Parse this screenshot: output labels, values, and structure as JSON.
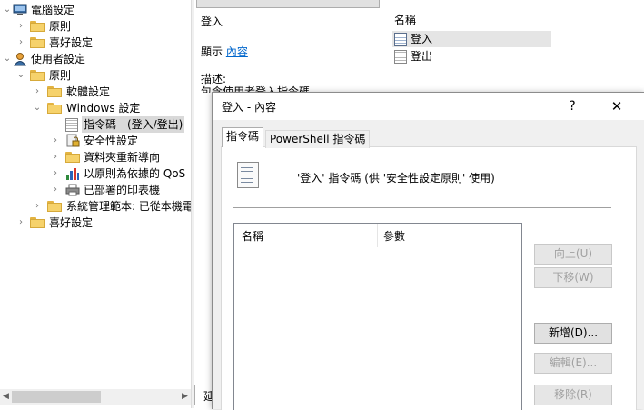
{
  "tree": {
    "items": [
      {
        "label": "電腦設定"
      },
      {
        "label": "原則"
      },
      {
        "label": "喜好設定"
      },
      {
        "label": "使用者設定"
      },
      {
        "label": "原則"
      },
      {
        "label": "軟體設定"
      },
      {
        "label": "Windows 設定"
      },
      {
        "label": "指令碼 - (登入/登出)"
      },
      {
        "label": "安全性設定"
      },
      {
        "label": "資料夾重新導向"
      },
      {
        "label": "以原則為依據的 QoS"
      },
      {
        "label": "已部署的印表機"
      },
      {
        "label": "系統管理範本: 已從本機電"
      },
      {
        "label": "喜好設定"
      }
    ]
  },
  "detail": {
    "title": "登入",
    "display_prefix": "顯示 ",
    "display_link": "內容",
    "desc_label": "描述:",
    "desc_text": "包含使用者登入指令碼。"
  },
  "list": {
    "header": "名稱",
    "items": [
      {
        "label": "登入"
      },
      {
        "label": "登出"
      }
    ]
  },
  "bottom_tab": "延",
  "dialog": {
    "title": "登入 - 內容",
    "help": "?",
    "close": "✕",
    "tabs": [
      "指令碼",
      "PowerShell 指令碼"
    ],
    "info": "'登入' 指令碼 (供 '安全性設定原則' 使用)",
    "table_headers": [
      "名稱",
      "參數"
    ],
    "buttons": {
      "up": "向上(U)",
      "down": "下移(W)",
      "add": "新增(D)...",
      "edit": "編輯(E)...",
      "remove": "移除(R)"
    }
  },
  "colors": {
    "accent_link": "#0066cc",
    "selection": "#d9d9d9"
  }
}
